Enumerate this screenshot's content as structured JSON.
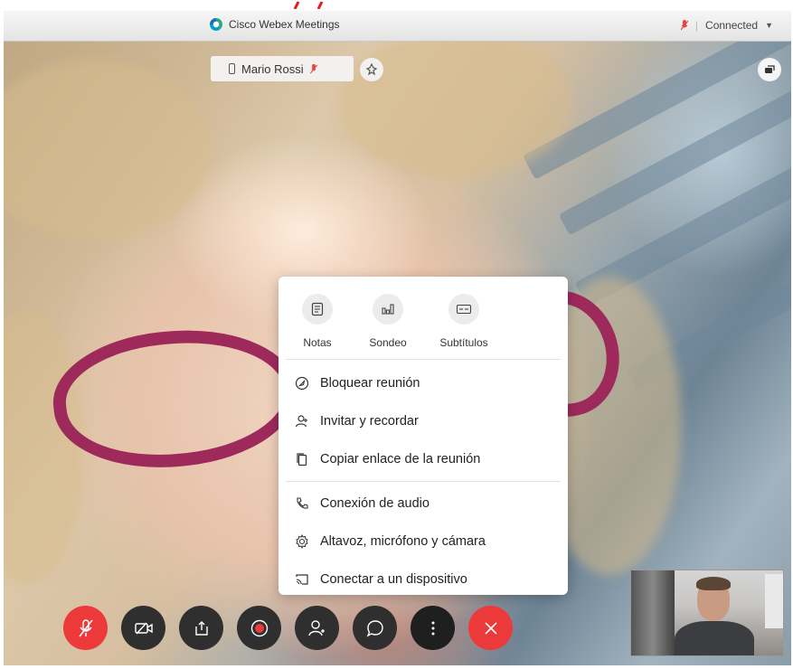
{
  "window": {
    "title": "Cisco Webex Meetings",
    "connection_status": "Connected"
  },
  "participant": {
    "name": "Mario Rossi"
  },
  "more_menu": {
    "quick_actions": [
      {
        "label": "Notas",
        "icon": "notes-icon"
      },
      {
        "label": "Sondeo",
        "icon": "poll-icon"
      },
      {
        "label": "Subtítulos",
        "icon": "captions-icon"
      }
    ],
    "items": [
      {
        "label": "Bloquear reunión",
        "icon": "lock-meeting-icon"
      },
      {
        "label": "Invitar y recordar",
        "icon": "invite-user-icon"
      },
      {
        "label": "Copiar enlace de la reunión",
        "icon": "copy-icon"
      },
      {
        "label": "Conexión de audio",
        "icon": "phone-icon"
      },
      {
        "label": "Altavoz, micrófono y cámara",
        "icon": "settings-gear-icon"
      },
      {
        "label": "Conectar a un dispositivo",
        "icon": "cast-device-icon"
      }
    ]
  },
  "toolbar": [
    {
      "name": "mute",
      "icon": "mic-muted-icon",
      "color": "#ec3a3a"
    },
    {
      "name": "video",
      "icon": "video-off-icon",
      "color": "#2f2f2f"
    },
    {
      "name": "share",
      "icon": "share-icon",
      "color": "#2f2f2f"
    },
    {
      "name": "record",
      "icon": "record-icon",
      "color": "#2f2f2f"
    },
    {
      "name": "participants",
      "icon": "participants-icon",
      "color": "#2f2f2f"
    },
    {
      "name": "chat",
      "icon": "chat-icon",
      "color": "#2f2f2f"
    },
    {
      "name": "more",
      "icon": "more-options-icon",
      "color": "#2f2f2f"
    },
    {
      "name": "leave",
      "icon": "close-icon",
      "color": "#ec3a3a"
    }
  ],
  "colors": {
    "accent_red": "#ec3a3a",
    "toolbar_dark": "#2f2f2f",
    "menu_bg": "#ffffff"
  }
}
